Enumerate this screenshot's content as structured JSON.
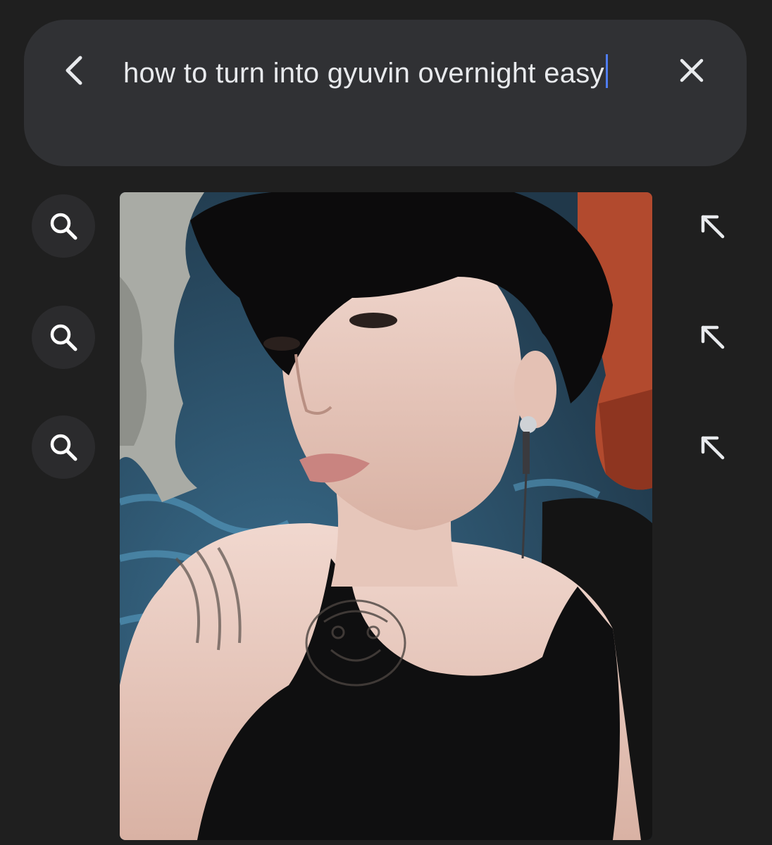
{
  "search": {
    "query_text": "how to turn into gyuvin overnight easy",
    "back_icon": "chevron-left-icon",
    "clear_icon": "close-icon"
  },
  "suggestions": [
    {
      "icon": "search-icon",
      "fill_icon": "arrow-up-left-icon"
    },
    {
      "icon": "search-icon",
      "fill_icon": "arrow-up-left-icon"
    },
    {
      "icon": "search-icon",
      "fill_icon": "arrow-up-left-icon"
    }
  ],
  "colors": {
    "background": "#1f1f1f",
    "search_bar": "#303134",
    "text": "#e8eaed",
    "caret": "#4f7df3"
  }
}
